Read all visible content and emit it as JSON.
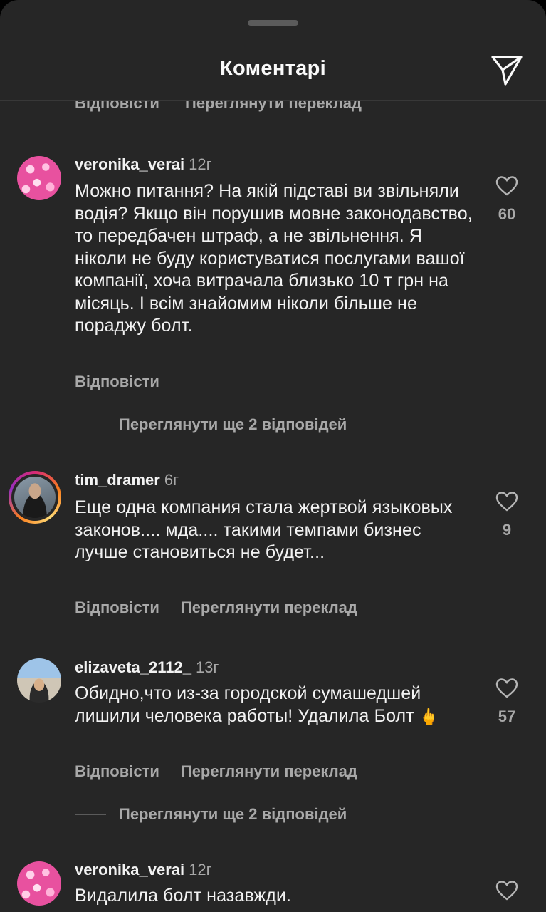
{
  "header": {
    "title": "Коментарі",
    "share_icon": "paper-plane-icon"
  },
  "top_partial": {
    "reply": "Відповісти",
    "translate": "Переглянути переклад"
  },
  "comments": [
    {
      "username": "veronika_verai",
      "time": "12г",
      "text": "Можно питання? На якій підставі ви звільняли водія? Якщо він порушив мовне законодавство, то передбачен штраф, а не звільнення. Я ніколи не буду користуватися послугами вашої компанії, хоча витрачала близько 10 т грн на місяць. І всім знайомим ніколи більше не пораджу болт.",
      "reply": "Відповісти",
      "likes": "60",
      "view_replies": "Переглянути ще 2 відповідей"
    },
    {
      "username": "tim_dramer",
      "time": "6г",
      "text": "Еще одна компания стала жертвой языковых законов.... мда.... такими темпами бизнес лучше становиться не будет...",
      "reply": "Відповісти",
      "translate": "Переглянути переклад",
      "likes": "9"
    },
    {
      "username": "elizaveta_2112_",
      "time": "13г",
      "text": "Обидно,что из-за городской сумашедшей лишили человека работы! Удалила Болт",
      "emoji": "🖕",
      "reply": "Відповісти",
      "translate": "Переглянути переклад",
      "likes": "57",
      "view_replies": "Переглянути ще 2 відповідей"
    },
    {
      "username": "veronika_verai",
      "time": "12г",
      "text": "Видалила болт назавжди."
    }
  ],
  "colors": {
    "background": "#262626",
    "text": "#f2f2f2",
    "secondary": "#a8a8a8"
  }
}
